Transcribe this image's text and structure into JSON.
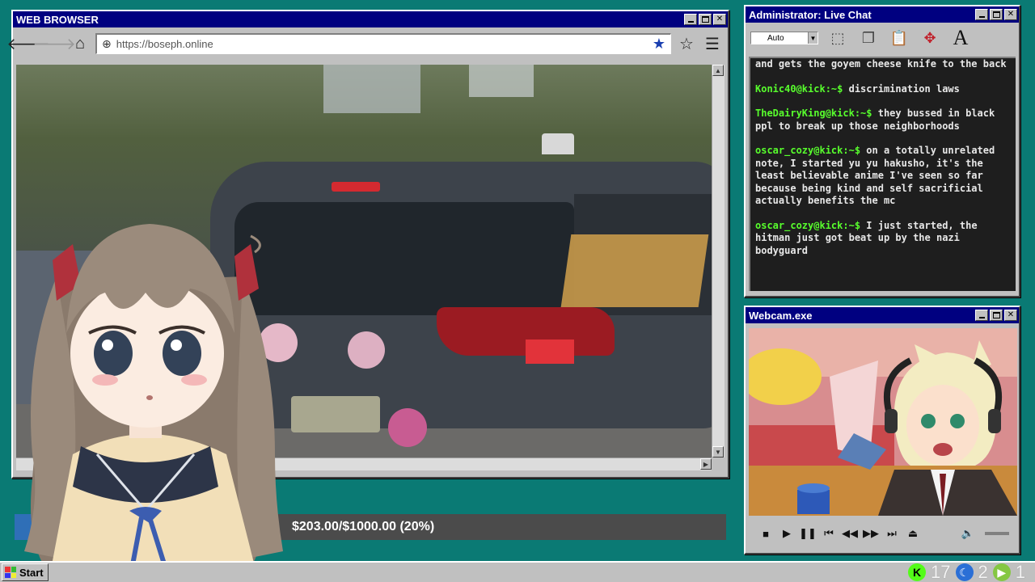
{
  "browser": {
    "title": "WEB BROWSER",
    "url": "https://boseph.online"
  },
  "donation": {
    "text": "$203.00/$1000.00 (20%)",
    "progress_fraction": 0.2,
    "fill_color": "#2f6fb7"
  },
  "chat": {
    "title": "Administrator: Live Chat",
    "font_size_select": "Auto",
    "messages": [
      {
        "user": "",
        "text": "and gets the goyem cheese knife to the back"
      },
      {
        "user": "Konic40@kick:~$",
        "text": "discrimination laws"
      },
      {
        "user": "TheDairyKing@kick:~$",
        "text": "they bussed in black ppl to break up those neighborhoods"
      },
      {
        "user": "oscar_cozy@kick:~$",
        "text": "on a totally unrelated note, I started yu yu hakusho, it's the least believable anime I've seen so far because being kind and self sacrificial actually benefits the mc"
      },
      {
        "user": "oscar_cozy@kick:~$",
        "text": "I just started, the hitman just got beat up by the nazi bodyguard"
      }
    ],
    "username_color": "#58ff2d"
  },
  "webcam": {
    "title": "Webcam.exe"
  },
  "taskbar": {
    "start_label": "Start",
    "tray": [
      {
        "icon": "kick-icon",
        "value": "17",
        "color": "#53fc18"
      },
      {
        "icon": "moon-icon",
        "value": "2",
        "color": "#2a6fd6"
      },
      {
        "icon": "rumble-icon",
        "value": "1",
        "color": "#85c742"
      }
    ]
  }
}
